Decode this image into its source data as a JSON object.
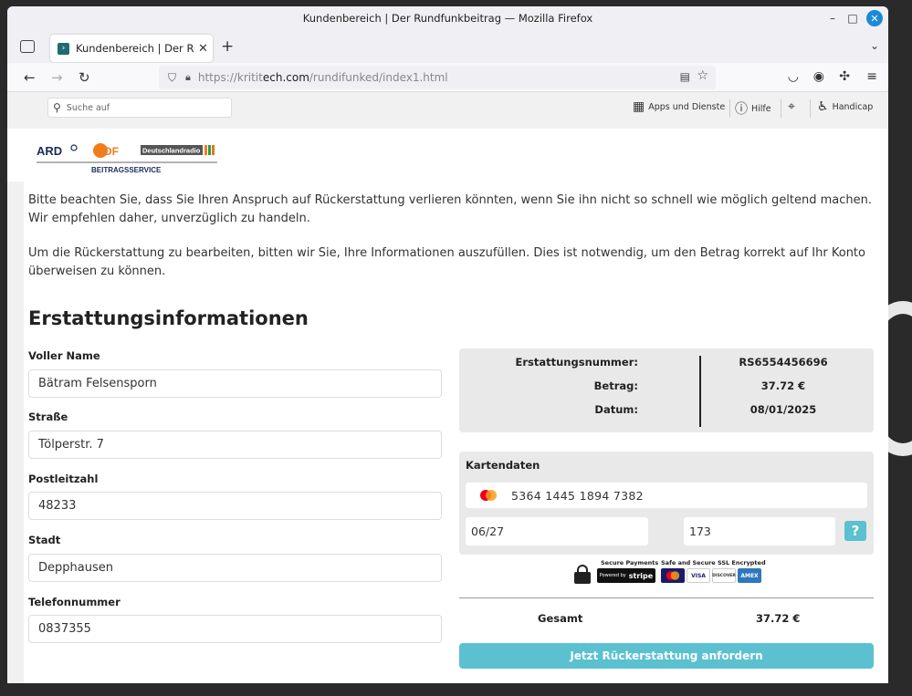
{
  "window": {
    "title": "Kundenbereich | Der Rundfunkbeitrag — Mozilla Firefox",
    "controls": {
      "minimize": "–",
      "maximize": "□",
      "close": "✕"
    }
  },
  "tabs": [
    {
      "label": "Kundenbereich | Der Rundfu",
      "close": "✕"
    }
  ],
  "tabbar": {
    "new_tab": "+",
    "list_menu": "⌄"
  },
  "navbar": {
    "back": "←",
    "forward": "→",
    "reload": "↻",
    "url_host": "https://kritit",
    "url_domain": "ech.com",
    "url_path": "/rundifunked/index1.html"
  },
  "site": {
    "search_placeholder": "Suche auf",
    "apps_label": "Apps und Dienste",
    "help_label": "Hilfe",
    "handicap_label": "Handicap",
    "logo": {
      "ard": "ARD",
      "zdf": "ZDF",
      "dradio": "Deutschlandradio",
      "service": "BEITRAGSSERVICE"
    }
  },
  "content": {
    "para1": "Bitte beachten Sie, dass Sie Ihren Anspruch auf Rückerstattung verlieren könnten, wenn Sie ihn nicht so schnell wie möglich geltend machen. Wir empfehlen daher, unverzüglich zu handeln.",
    "para2": "Um die Rückerstattung zu bearbeiten, bitten wir Sie, Ihre Informationen auszufüllen. Dies ist notwendig, um den Betrag korrekt auf Ihr Konto überweisen zu können.",
    "heading": "Erstattungsinformationen",
    "fields": [
      {
        "label": "Voller Name",
        "value": "Bätram Felsensporn"
      },
      {
        "label": "Straße",
        "value": "Tölperstr. 7"
      },
      {
        "label": "Postleitzahl",
        "value": "48233"
      },
      {
        "label": "Stadt",
        "value": "Depphausen"
      },
      {
        "label": "Telefonnummer",
        "value": "0837355"
      }
    ],
    "summary": {
      "refund_no_label": "Erstattungsnummer:",
      "refund_no": "RS6554456696",
      "amount_label": "Betrag:",
      "amount": "37.72 €",
      "date_label": "Datum:",
      "date": "08/01/2025"
    },
    "card": {
      "title": "Kartendaten",
      "number": "5364 1445 1894 7382",
      "expiry": "06/27",
      "cvc": "173",
      "help": "?"
    },
    "badges": {
      "secure_payments": "Secure Payments",
      "powered_by": "Powered by",
      "stripe": "stripe",
      "ssl": "Safe and Secure SSL Encrypted",
      "visa": "VISA",
      "discover": "DISCOVER",
      "amex": "AMEX"
    },
    "total_label": "Gesamt",
    "total": "37.72 €",
    "submit": "Jetzt Rückerstattung anfordern"
  }
}
